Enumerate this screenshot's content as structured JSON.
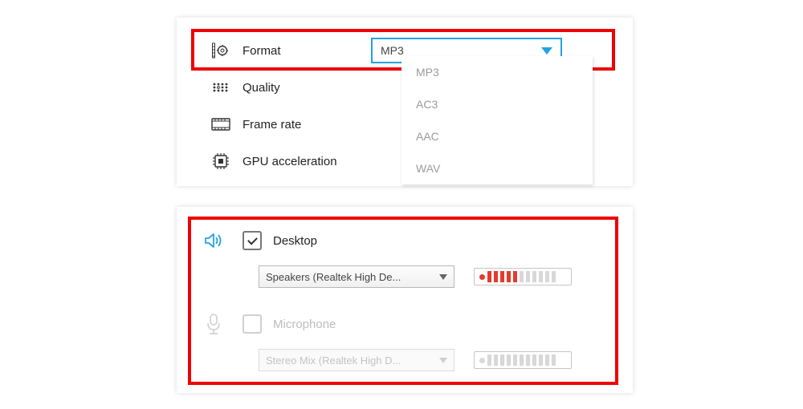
{
  "settings": {
    "rows": [
      {
        "key": "format",
        "label": "Format"
      },
      {
        "key": "quality",
        "label": "Quality"
      },
      {
        "key": "frame_rate",
        "label": "Frame rate"
      },
      {
        "key": "gpu",
        "label": "GPU acceleration"
      }
    ],
    "format_selected": "MP3",
    "format_options": [
      "MP3",
      "AC3",
      "AAC",
      "WAV"
    ]
  },
  "audio": {
    "desktop": {
      "label": "Desktop",
      "checked": true,
      "device": "Speakers (Realtek High De...",
      "meter_active_bars": 5,
      "meter_total_bars": 11
    },
    "microphone": {
      "label": "Microphone",
      "checked": false,
      "enabled": false,
      "device": "Stereo Mix (Realtek High D...",
      "meter_active_bars": 0,
      "meter_total_bars": 11
    }
  },
  "colors": {
    "highlight": "#f00000",
    "accent_blue": "#23a2e5",
    "meter_on": "#e43b2d"
  }
}
